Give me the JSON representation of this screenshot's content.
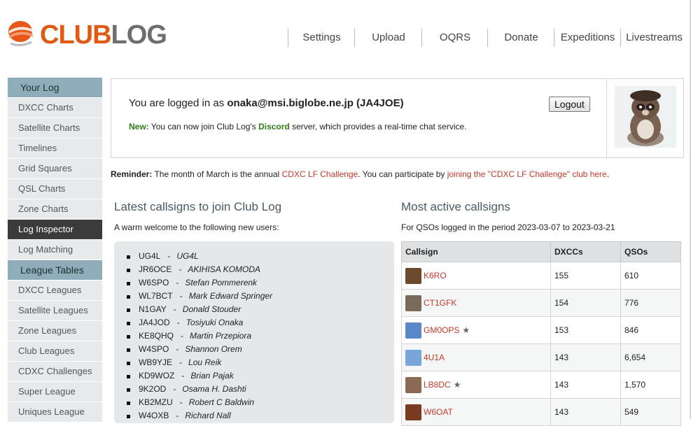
{
  "header": {
    "logo": {
      "club": "CLUB",
      "log": "LOG"
    },
    "nav": [
      "Settings",
      "Upload",
      "OQRS",
      "Donate",
      "Expeditions",
      "Livestreams"
    ]
  },
  "sidebar": [
    {
      "label": "Your Log",
      "type": "head"
    },
    {
      "label": "DXCC Charts",
      "type": "item"
    },
    {
      "label": "Satellite Charts",
      "type": "item"
    },
    {
      "label": "Timelines",
      "type": "item"
    },
    {
      "label": "Grid Squares",
      "type": "item"
    },
    {
      "label": "QSL Charts",
      "type": "item"
    },
    {
      "label": "Zone Charts",
      "type": "item"
    },
    {
      "label": "Log Inspector",
      "type": "active"
    },
    {
      "label": "Log Matching",
      "type": "item"
    },
    {
      "label": "League Tables",
      "type": "head"
    },
    {
      "label": "DXCC Leagues",
      "type": "item"
    },
    {
      "label": "Satellite Leagues",
      "type": "item"
    },
    {
      "label": "Zone Leagues",
      "type": "item"
    },
    {
      "label": "Club Leagues",
      "type": "item"
    },
    {
      "label": "CDXC Challenges",
      "type": "item"
    },
    {
      "label": "Super League",
      "type": "item"
    },
    {
      "label": "Uniques League",
      "type": "item"
    }
  ],
  "login": {
    "prefix": "You are logged in as ",
    "user": "onaka@msi.biglobe.ne.jp (JA4JOE)",
    "logout": "Logout",
    "new_label": "New:",
    "new_text_1": " You can now join Club Log's ",
    "discord": "Discord",
    "new_text_2": " server, which provides a real-time chat service."
  },
  "reminder": {
    "label": "Reminder:",
    "text_1": " The month of March is the annual ",
    "link_1": "CDXC LF Challenge",
    "text_2": ". You can participate by ",
    "link_2": "joining the \"CDXC LF Challenge\" club here",
    "text_3": "."
  },
  "latest": {
    "title": "Latest callsigns to join Club Log",
    "subtitle": "A warm welcome to the following new users:",
    "users": [
      {
        "call": "UG4L",
        "name": "UG4L"
      },
      {
        "call": "JR6OCE",
        "name": "AKIHISA KOMODA"
      },
      {
        "call": "W6SPO",
        "name": "Stefan Pommerenk"
      },
      {
        "call": "WL7BCT",
        "name": "Mark Edward Springer"
      },
      {
        "call": "N1GAY",
        "name": "Donald Stouder"
      },
      {
        "call": "JA4JOD",
        "name": "Tosiyuki Onaka"
      },
      {
        "call": "KE8QHQ",
        "name": "Martin Przepiora"
      },
      {
        "call": "W4SPO",
        "name": "Shannon Orem"
      },
      {
        "call": "WB9YJE",
        "name": "Lou Reik"
      },
      {
        "call": "KD9WOZ",
        "name": "Brian Pajak"
      },
      {
        "call": "9K2OD",
        "name": "Osama H. Dashti"
      },
      {
        "call": "KB2MZU",
        "name": "Robert C Baldwin"
      },
      {
        "call": "W4OXB",
        "name": "Richard Nall"
      }
    ]
  },
  "active": {
    "title": "Most active callsigns",
    "subtitle": "For QSOs logged in the period 2023-03-07 to 2023-03-21",
    "columns": [
      "Callsign",
      "DXCCs",
      "QSOs"
    ],
    "rows": [
      {
        "call": "K6RO",
        "dxcc": "155",
        "qsos": "610",
        "star": "",
        "avatar_color": "#6b4a2e"
      },
      {
        "call": "CT1GFK",
        "dxcc": "154",
        "qsos": "776",
        "star": "",
        "avatar_color": "#7a6a5a"
      },
      {
        "call": "GM0OPS",
        "dxcc": "153",
        "qsos": "846",
        "star": "★",
        "avatar_color": "#5a87c8"
      },
      {
        "call": "4U1A",
        "dxcc": "143",
        "qsos": "6,654",
        "star": "",
        "avatar_color": "#78a6d8"
      },
      {
        "call": "LB8DC",
        "dxcc": "143",
        "qsos": "1,570",
        "star": "★",
        "avatar_color": "#8a6a52"
      },
      {
        "call": "W6OAT",
        "dxcc": "143",
        "qsos": "549",
        "star": "",
        "avatar_color": "#7a3a22"
      }
    ]
  }
}
